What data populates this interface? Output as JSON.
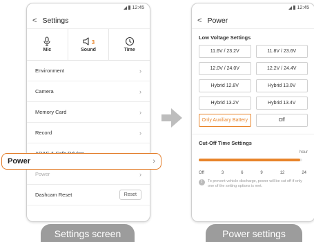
{
  "left_screen": {
    "status_time": "12:45",
    "title": "Settings",
    "back_glyph": "<",
    "icons": [
      {
        "label": "Mic",
        "icon": "mic-icon"
      },
      {
        "label": "Sound",
        "icon": "speaker-icon",
        "count": "3"
      },
      {
        "label": "Time",
        "icon": "clock-icon"
      }
    ],
    "menu": [
      {
        "label": "Environment"
      },
      {
        "label": "Camera"
      },
      {
        "label": "Memory Card"
      },
      {
        "label": "Record"
      },
      {
        "label": "ADAS & Safe Driving"
      },
      {
        "label": "Power"
      },
      {
        "label": "Dashcam Reset",
        "button": "Reset"
      }
    ],
    "highlight_label": "Power"
  },
  "right_screen": {
    "status_time": "12:45",
    "title": "Power",
    "low_voltage_title": "Low Voltage Settings",
    "voltage_options": [
      "11.6V / 23.2V",
      "11.8V / 23.6V",
      "12.0V / 24.0V",
      "12.2V / 24.4V",
      "Hybrid 12.8V",
      "Hybrid 13.0V",
      "Hybrid 13.2V",
      "Hybrid 13.4V",
      "Only Auxiliary Battery",
      "Off"
    ],
    "active_option": "Only Auxiliary Battery",
    "cutoff_title": "Cut-Off Time Settings",
    "slider_unit": "hour",
    "slider_ticks": [
      "Off",
      "3",
      "6",
      "9",
      "12",
      "24"
    ],
    "slider_value_fraction": 0.98,
    "note": "To prevent vehicle discharge, power will be cut off if only one of the setting options is met."
  },
  "captions": {
    "left": "Settings screen",
    "right": "Power settings"
  },
  "colors": {
    "accent": "#e8842a",
    "caption_bg": "#9c9c9c"
  }
}
